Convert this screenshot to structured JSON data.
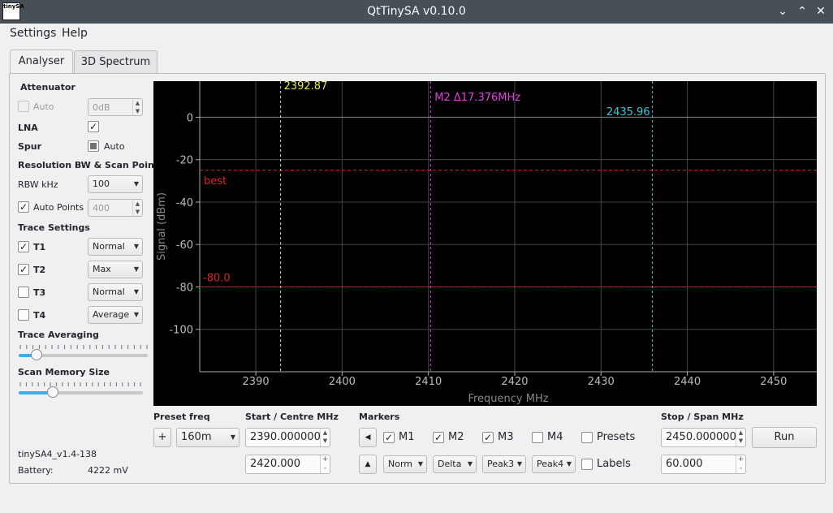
{
  "window": {
    "title": "QtTinySA v0.10.0",
    "icon_text": "tinySA"
  },
  "menu": {
    "settings": "Settings",
    "help": "Help"
  },
  "tabs": [
    "Analyser",
    "3D Spectrum"
  ],
  "sidebar": {
    "attenuator": {
      "heading": "Attenuator",
      "auto_label": "Auto",
      "auto_checked": false,
      "value": "0dB"
    },
    "lna": {
      "label": "LNA",
      "checked": true
    },
    "spur": {
      "label": "Spur",
      "auto_label": "Auto"
    },
    "rbw": {
      "heading": "Resolution BW & Scan Points",
      "label": "RBW kHz",
      "value": "100",
      "auto_points_label": "Auto Points",
      "auto_points_checked": true,
      "points": "400"
    },
    "trace_settings": {
      "heading": "Trace Settings",
      "traces": [
        {
          "label": "T1",
          "checked": true,
          "mode": "Normal"
        },
        {
          "label": "T2",
          "checked": true,
          "mode": "Max"
        },
        {
          "label": "T3",
          "checked": false,
          "mode": "Normal"
        },
        {
          "label": "T4",
          "checked": false,
          "mode": "Average"
        }
      ]
    },
    "trace_averaging": {
      "heading": "Trace Averaging",
      "level": 0.1
    },
    "scan_memory": {
      "heading": "Scan Memory Size",
      "level": 0.25
    },
    "device": "tinySA4_v1.4-138",
    "battery_label": "Battery:",
    "battery_value": "4222 mV"
  },
  "plot": {
    "ylabel": "Signal (dBm)",
    "xlabel": "Frequency MHz",
    "yticks": [
      "0",
      "-20",
      "-40",
      "-60",
      "-80",
      "-100"
    ],
    "xticks": [
      "2390",
      "2400",
      "2410",
      "2420",
      "2430",
      "2440",
      "2450"
    ],
    "marker1_label": "2392.87",
    "marker2_label": "M2 Δ17.376MHz",
    "marker3_label": "2435.96",
    "best_label": "best",
    "threshold_label": "-80.0",
    "colors": {
      "m1": "#e8e840",
      "m2": "#e040e0",
      "m3": "#3cc8d8",
      "threshold": "#e02020",
      "grid": "#444444"
    }
  },
  "chart_data": {
    "type": "line",
    "xlabel": "Frequency MHz",
    "ylabel": "Signal (dBm)",
    "xlim": [
      2383.5,
      2455
    ],
    "ylim": [
      -120,
      17
    ],
    "grid": true,
    "markers": [
      {
        "name": "M1",
        "x": 2392.87
      },
      {
        "name": "M2",
        "x": 2410.246
      },
      {
        "name": "M3",
        "x": 2435.96
      }
    ],
    "hlines": [
      {
        "label": "best",
        "y": -25
      },
      {
        "label": "-80.0",
        "y": -80
      }
    ]
  },
  "bottom": {
    "preset_heading": "Preset freq",
    "preset_value": "160m",
    "plus_label": "+",
    "start_heading": "Start / Centre MHz",
    "start_value": "2390.000000",
    "centre_value": "2420.000",
    "markers_heading": "Markers",
    "markers": [
      {
        "label": "M1",
        "checked": true,
        "mode": "Norm"
      },
      {
        "label": "M2",
        "checked": true,
        "mode": "Delta"
      },
      {
        "label": "M3",
        "checked": true,
        "mode": "Peak3"
      },
      {
        "label": "M4",
        "checked": false,
        "mode": "Peak4"
      }
    ],
    "presets_label": "Presets",
    "labels_label": "Labels",
    "stop_heading": "Stop / Span MHz",
    "stop_value": "2450.000000",
    "span_value": "60.000",
    "run_label": "Run"
  }
}
